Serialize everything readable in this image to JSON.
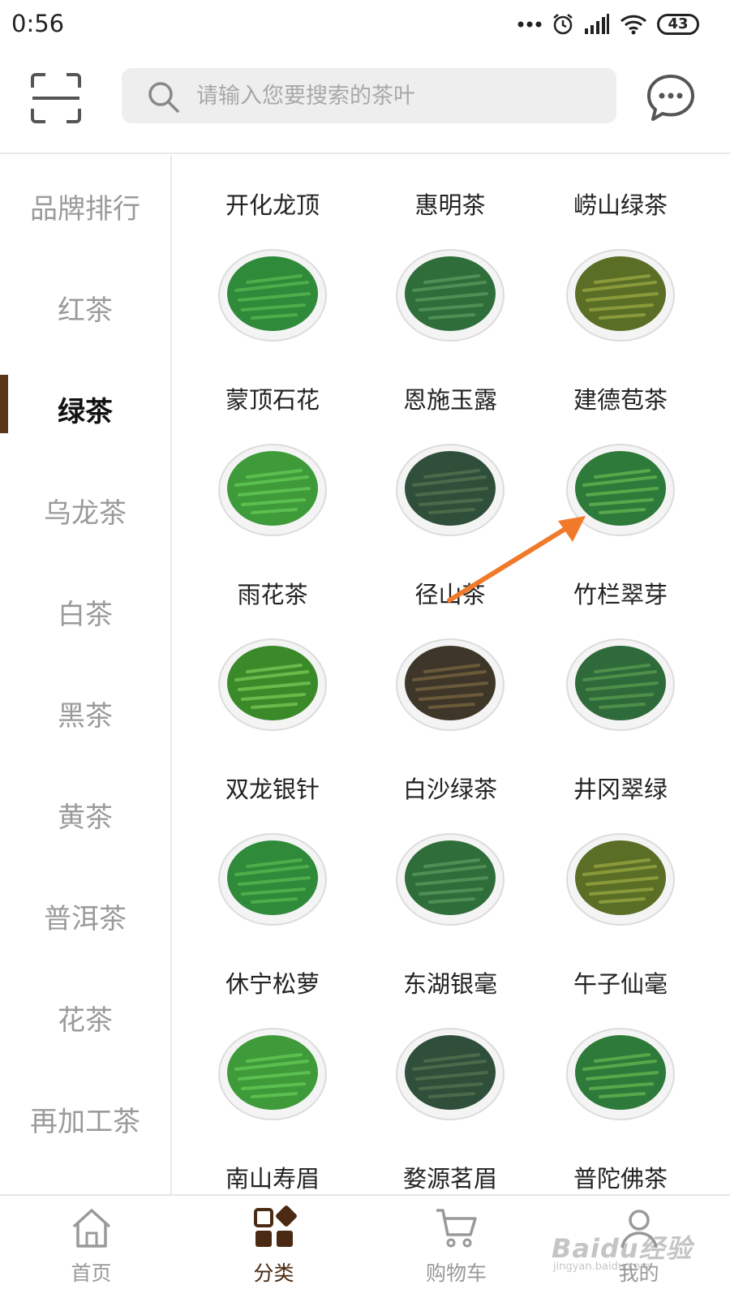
{
  "status_bar": {
    "time": "0:56",
    "battery": "43",
    "icons": [
      "dots-icon",
      "alarm-icon",
      "signal-icon",
      "wifi-icon",
      "battery-icon"
    ]
  },
  "header": {
    "scan_icon": "scan-icon",
    "search": {
      "placeholder": "请输入您要搜索的茶叶",
      "icon": "search-icon"
    },
    "message_icon": "message-icon"
  },
  "sidebar": {
    "items": [
      {
        "label": "品牌排行"
      },
      {
        "label": "红茶"
      },
      {
        "label": "绿茶",
        "active": true
      },
      {
        "label": "乌龙茶"
      },
      {
        "label": "白茶"
      },
      {
        "label": "黑茶"
      },
      {
        "label": "黄茶"
      },
      {
        "label": "普洱茶"
      },
      {
        "label": "花茶"
      },
      {
        "label": "再加工茶"
      }
    ],
    "active_color": "#5a3416"
  },
  "grid": {
    "rows": [
      [
        {
          "name": "开化龙顶"
        },
        {
          "name": "惠明茶"
        },
        {
          "name": "崂山绿茶"
        }
      ],
      [
        {
          "name": "蒙顶石花"
        },
        {
          "name": "恩施玉露"
        },
        {
          "name": "建德苞茶"
        }
      ],
      [
        {
          "name": "雨花茶"
        },
        {
          "name": "径山茶"
        },
        {
          "name": "竹栏翠芽"
        }
      ],
      [
        {
          "name": "双龙银针"
        },
        {
          "name": "白沙绿茶"
        },
        {
          "name": "井冈翠绿"
        }
      ],
      [
        {
          "name": "休宁松萝"
        },
        {
          "name": "东湖银毫"
        },
        {
          "name": "午子仙毫"
        }
      ],
      [
        {
          "name": "南山寿眉"
        },
        {
          "name": "婺源茗眉"
        },
        {
          "name": "普陀佛茶"
        }
      ]
    ]
  },
  "annotation": {
    "color": "#f07a2a"
  },
  "bottom_nav": {
    "items": [
      {
        "label": "首页",
        "icon": "home-icon"
      },
      {
        "label": "分类",
        "icon": "category-icon",
        "active": true
      },
      {
        "label": "购物车",
        "icon": "cart-icon"
      },
      {
        "label": "我的",
        "icon": "user-icon"
      }
    ]
  },
  "watermark": {
    "main": "Baidu经验",
    "sub": "jingyan.baidu.com"
  }
}
